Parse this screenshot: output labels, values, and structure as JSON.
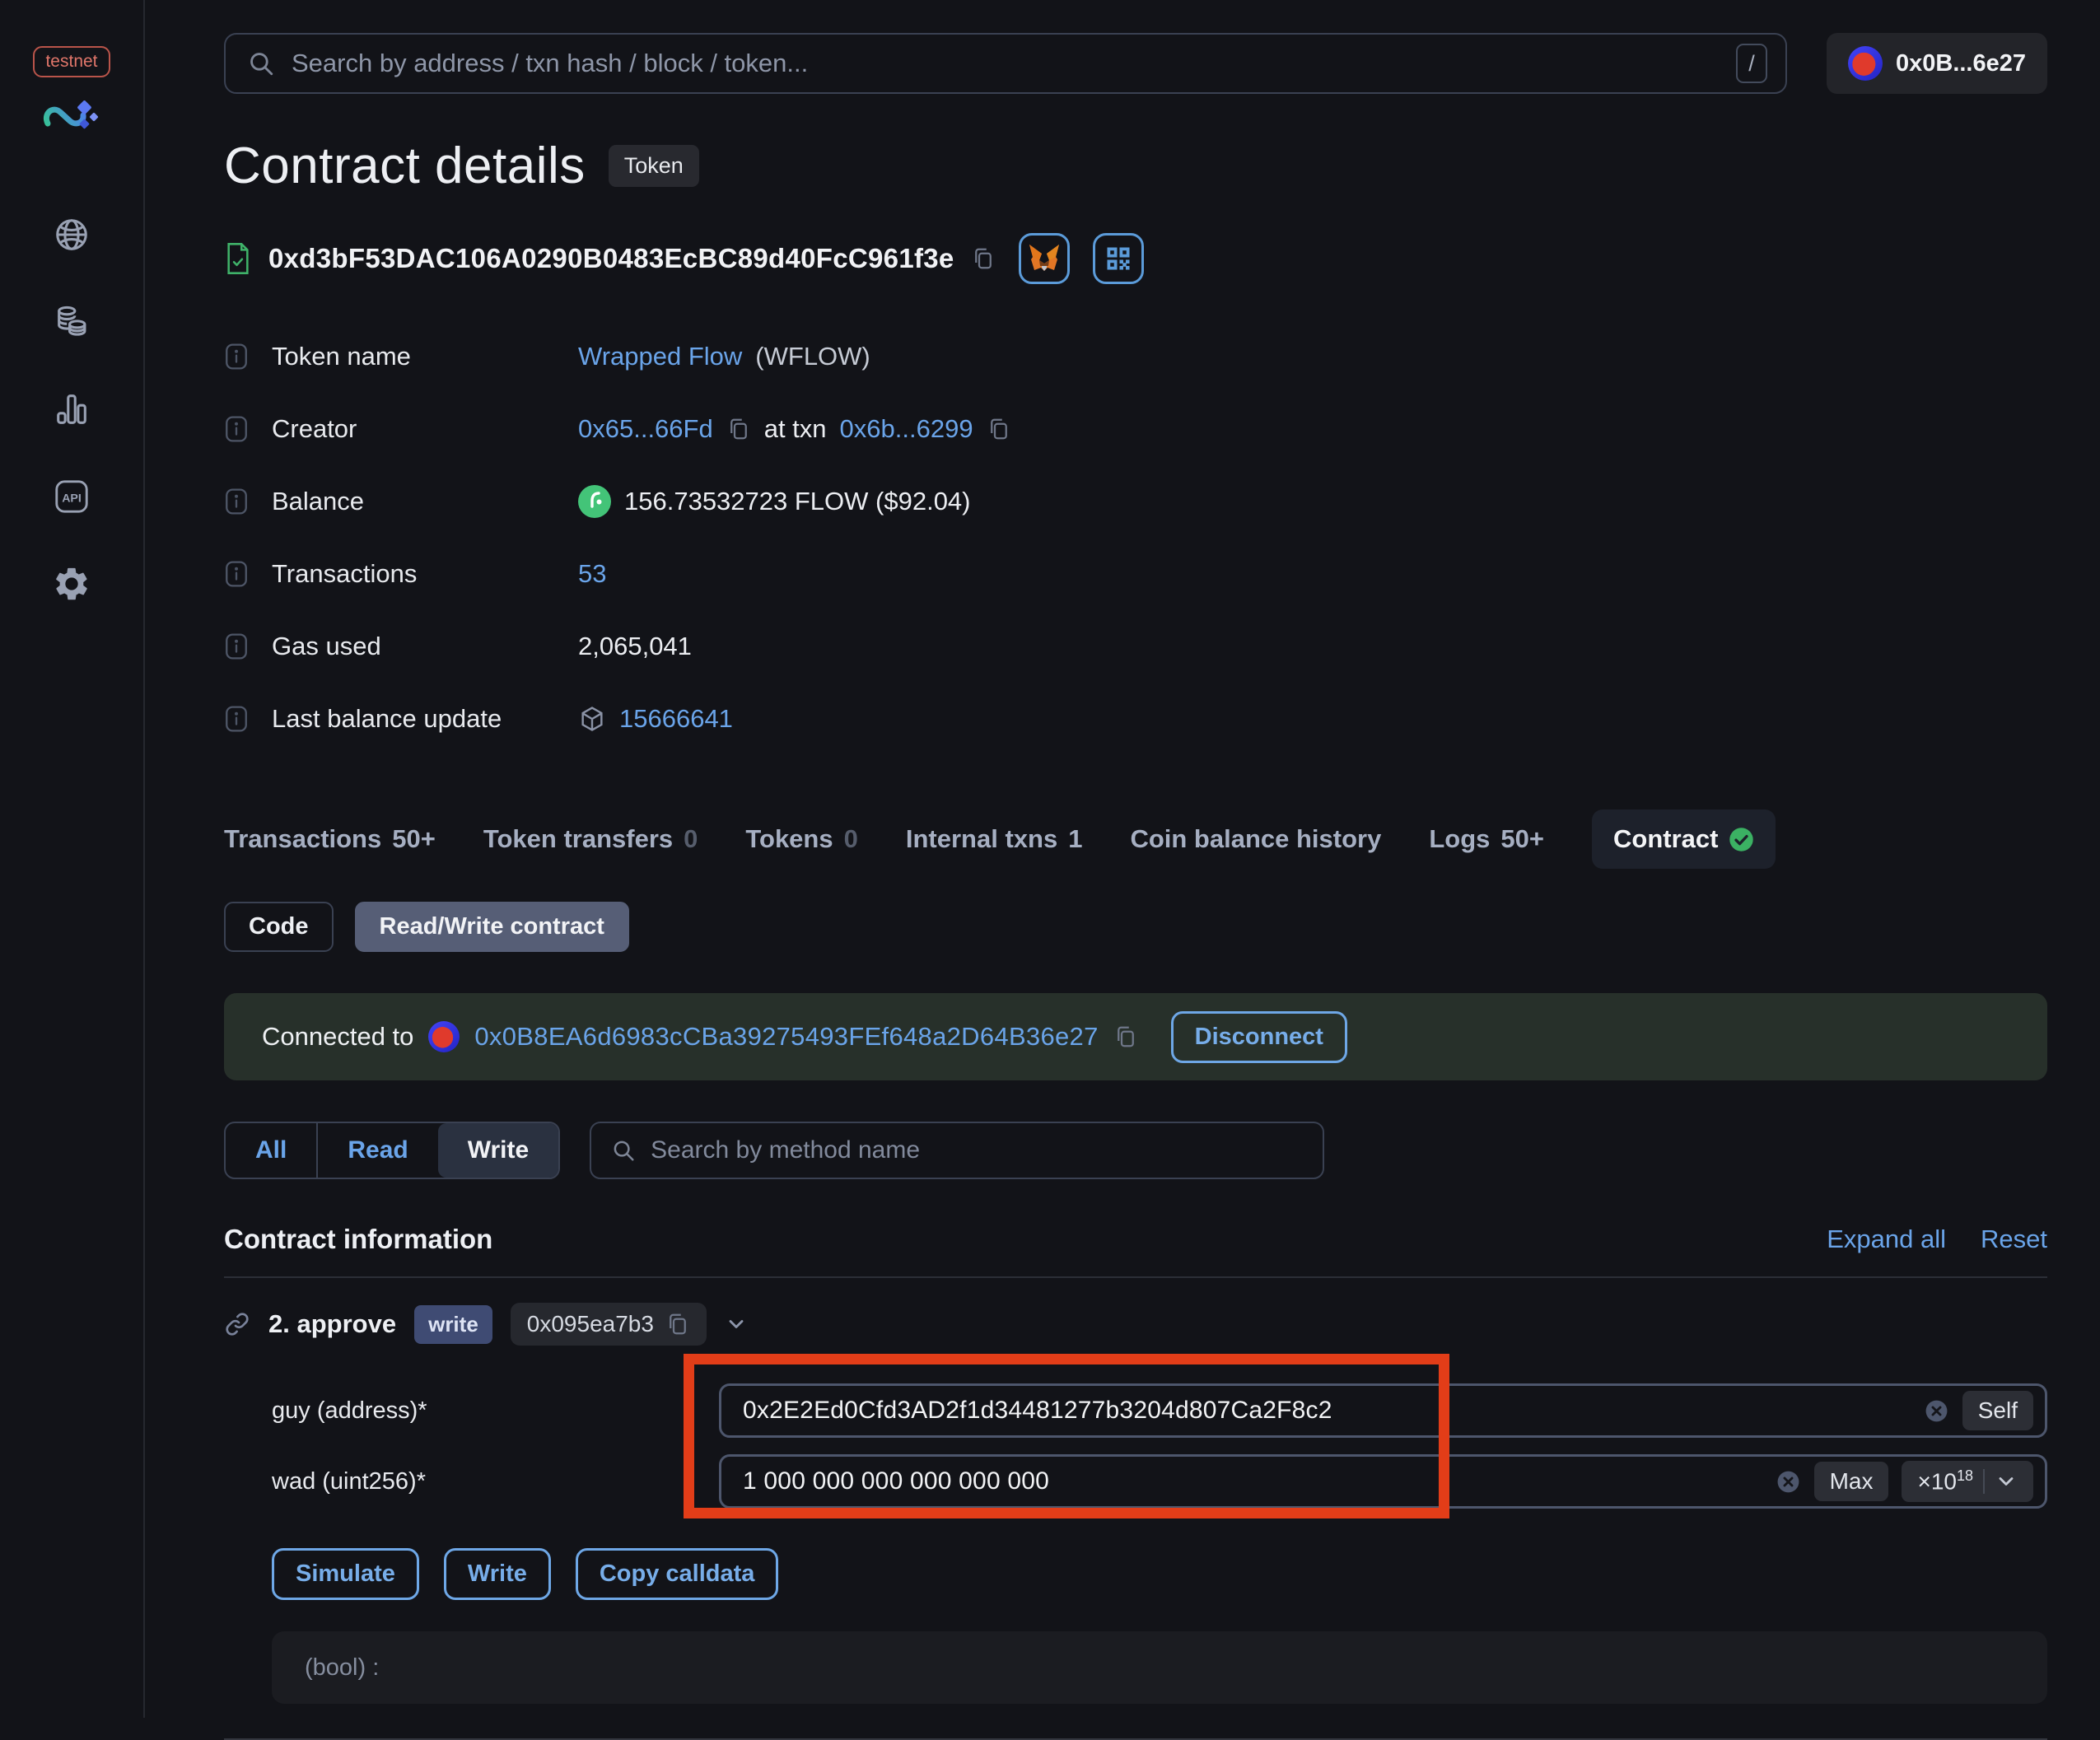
{
  "sidebar": {
    "network_badge": "testnet",
    "api_icon_label": "API",
    "items": [
      {
        "icon": "globe"
      },
      {
        "icon": "tokens"
      },
      {
        "icon": "stats"
      },
      {
        "icon": "api"
      },
      {
        "icon": "settings"
      }
    ]
  },
  "header": {
    "search_placeholder": "Search by address / txn hash / block / token...",
    "search_shortcut": "/",
    "wallet_address_short": "0x0B...6e27"
  },
  "page": {
    "title": "Contract details",
    "type_badge": "Token",
    "contract_address": "0xd3bF53DAC106A0290B0483EcBC89d40FcC961f3e"
  },
  "info": {
    "token_name": {
      "label": "Token name",
      "link": "Wrapped Flow",
      "suffix": "(WFLOW)"
    },
    "creator": {
      "label": "Creator",
      "creator_link": "0x65...66Fd",
      "at_txn": "at txn",
      "txn_link": "0x6b...6299"
    },
    "balance": {
      "label": "Balance",
      "value": "156.73532723 FLOW ($92.04)"
    },
    "transactions": {
      "label": "Transactions",
      "value": "53"
    },
    "gas_used": {
      "label": "Gas used",
      "value": "2,065,041"
    },
    "last_balance_update": {
      "label": "Last balance update",
      "value": "15666641"
    }
  },
  "tabs": {
    "items": [
      {
        "label": "Transactions",
        "count": "50+"
      },
      {
        "label": "Token transfers",
        "count": "0"
      },
      {
        "label": "Tokens",
        "count": "0"
      },
      {
        "label": "Internal txns",
        "count": "1"
      },
      {
        "label": "Coin balance history",
        "count": ""
      },
      {
        "label": "Logs",
        "count": "50+"
      },
      {
        "label": "Contract",
        "count": "",
        "selected": true
      }
    ]
  },
  "subtabs": {
    "code": "Code",
    "read_write": "Read/Write contract"
  },
  "connection": {
    "label": "Connected to",
    "address": "0x0B8EA6d6983cCBa39275493FEf648a2D64B36e27",
    "disconnect": "Disconnect"
  },
  "filters": {
    "all": "All",
    "read": "Read",
    "write": "Write",
    "selected": "Write",
    "search_placeholder": "Search by method name"
  },
  "contract_section": {
    "title": "Contract information",
    "expand_all": "Expand all",
    "reset": "Reset"
  },
  "method": {
    "index": "2.",
    "name": "approve",
    "badge": "write",
    "selector": "0x095ea7b3",
    "fields": {
      "guy": {
        "label": "guy (address)*",
        "value": "0x2E2Ed0Cfd3AD2f1d34481277b3204d807Ca2F8c2",
        "action": "Self"
      },
      "wad": {
        "label": "wad (uint256)*",
        "value": "1 000 000 000 000 000 000",
        "action": "Max",
        "multiplier_base": "×10",
        "multiplier_exp": "18"
      }
    },
    "actions": {
      "simulate": "Simulate",
      "write": "Write",
      "copy_calldata": "Copy calldata"
    },
    "output": "(bool) :"
  },
  "annotation": {
    "highlight_color": "#e23d18"
  },
  "colors": {
    "background": "#121318",
    "link_blue": "#6aa4e9",
    "accent_blue": "#6ea7e6",
    "verified_green": "#3fb269",
    "banner_green": "#27302a",
    "highlight_red": "#e23d18"
  }
}
